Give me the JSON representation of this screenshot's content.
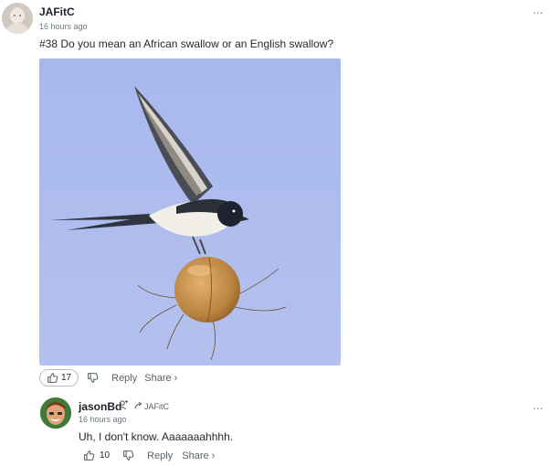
{
  "comments": [
    {
      "author": "JAFitC",
      "time": "16 hours ago",
      "text": "#38 Do you mean an African swallow or an English swallow?",
      "likes": "17",
      "reply_label": "Reply",
      "share_label": "Share ›"
    }
  ],
  "replies": [
    {
      "author": "jasonBd",
      "reply_to": "JAFitC",
      "time": "16 hours ago",
      "text": "Uh, I don't know. Aaaaaaahhhh.",
      "likes": "10",
      "reply_label": "Reply",
      "share_label": "Share ›"
    }
  ],
  "icons": {
    "like": "thumbs-up-icon",
    "dislike": "thumbs-down-icon",
    "more": "more-options-icon",
    "follow": "add-follower-icon",
    "reply_arrow": "reply-arrow-icon"
  },
  "colors": {
    "sky": "#a9b9ec",
    "text": "#232a31",
    "muted": "#6e7780"
  }
}
